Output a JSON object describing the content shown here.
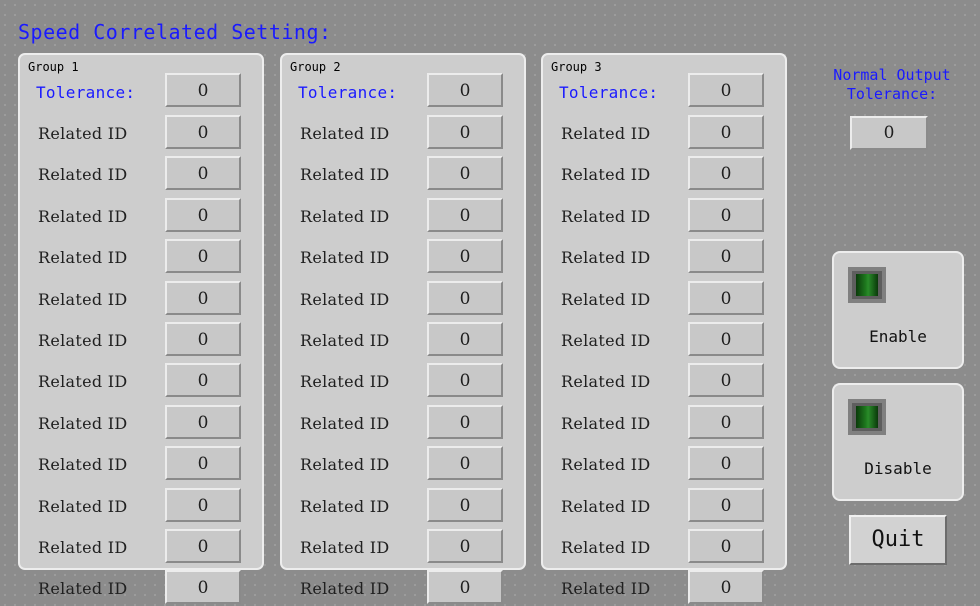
{
  "title": "Speed Correlated Setting:",
  "groups": [
    {
      "title": "Group 1",
      "tolerance_label": "Tolerance:",
      "tolerance_value": "0",
      "rows": [
        {
          "label": "Related ID",
          "value": "0"
        },
        {
          "label": "Related ID",
          "value": "0"
        },
        {
          "label": "Related ID",
          "value": "0"
        },
        {
          "label": "Related ID",
          "value": "0"
        },
        {
          "label": "Related ID",
          "value": "0"
        },
        {
          "label": "Related ID",
          "value": "0"
        },
        {
          "label": "Related ID",
          "value": "0"
        },
        {
          "label": "Related ID",
          "value": "0"
        },
        {
          "label": "Related ID",
          "value": "0"
        },
        {
          "label": "Related ID",
          "value": "0"
        },
        {
          "label": "Related ID",
          "value": "0"
        },
        {
          "label": "Related ID",
          "value": "0"
        }
      ]
    },
    {
      "title": "Group 2",
      "tolerance_label": "Tolerance:",
      "tolerance_value": "0",
      "rows": [
        {
          "label": "Related ID",
          "value": "0"
        },
        {
          "label": "Related ID",
          "value": "0"
        },
        {
          "label": "Related ID",
          "value": "0"
        },
        {
          "label": "Related ID",
          "value": "0"
        },
        {
          "label": "Related ID",
          "value": "0"
        },
        {
          "label": "Related ID",
          "value": "0"
        },
        {
          "label": "Related ID",
          "value": "0"
        },
        {
          "label": "Related ID",
          "value": "0"
        },
        {
          "label": "Related ID",
          "value": "0"
        },
        {
          "label": "Related ID",
          "value": "0"
        },
        {
          "label": "Related ID",
          "value": "0"
        },
        {
          "label": "Related ID",
          "value": "0"
        }
      ]
    },
    {
      "title": "Group 3",
      "tolerance_label": "Tolerance:",
      "tolerance_value": "0",
      "rows": [
        {
          "label": "Related ID",
          "value": "0"
        },
        {
          "label": "Related ID",
          "value": "0"
        },
        {
          "label": "Related ID",
          "value": "0"
        },
        {
          "label": "Related ID",
          "value": "0"
        },
        {
          "label": "Related ID",
          "value": "0"
        },
        {
          "label": "Related ID",
          "value": "0"
        },
        {
          "label": "Related ID",
          "value": "0"
        },
        {
          "label": "Related ID",
          "value": "0"
        },
        {
          "label": "Related ID",
          "value": "0"
        },
        {
          "label": "Related ID",
          "value": "0"
        },
        {
          "label": "Related ID",
          "value": "0"
        },
        {
          "label": "Related ID",
          "value": "0"
        }
      ]
    }
  ],
  "normal_output": {
    "label_line1": "Normal Output",
    "label_line2": "Tolerance:",
    "value": "0"
  },
  "enable": {
    "label": "Enable",
    "lamp_color": "#1f7a1f",
    "lamp_icon": "indicator-lamp-icon"
  },
  "disable": {
    "label": "Disable",
    "lamp_color": "#1f7a1f",
    "lamp_icon": "indicator-lamp-icon"
  },
  "quit_label": "Quit",
  "colors": {
    "title_blue": "#1a1aff",
    "panel_gray": "#cdcdcd",
    "background_gray": "#8c8c8c"
  }
}
